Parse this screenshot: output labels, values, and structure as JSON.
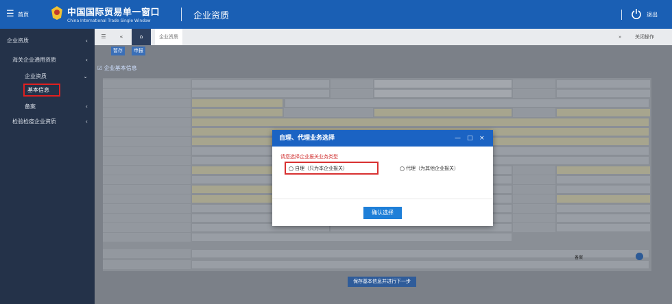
{
  "header": {
    "home_label": "首页",
    "brand_cn": "中国国际贸易单一窗口",
    "brand_en": "China International Trade Single Window",
    "module_title": "企业资质",
    "user_label": "退出"
  },
  "sidebar": {
    "items": [
      {
        "label": "企业资质"
      },
      {
        "label": "海关企业通用资质"
      },
      {
        "label": "企业资质"
      },
      {
        "label": "基本信息"
      },
      {
        "label": "备案"
      },
      {
        "label": "检验检疫企业资质"
      }
    ]
  },
  "tabbar": {
    "tab_label": "企业资质",
    "right_label": "关闭操作"
  },
  "actions": {
    "btn1": "暂存",
    "btn2": "申报"
  },
  "section": {
    "title": "企业基本信息"
  },
  "modal": {
    "title": "自理、代理业务选择",
    "question": "请您选择企业报关业务类型",
    "option1": "自理（只为本企业报关）",
    "option2": "代理（为其他企业报关）",
    "confirm": "确认选择"
  },
  "footer": {
    "next": "保存基本信息并进行下一步",
    "tag": "备案"
  },
  "colors": {
    "header": "#1a5fb4",
    "sidebar": "#243249",
    "modal_head": "#1b63c3",
    "confirm": "#1e7fd8",
    "highlight": "#d83030"
  }
}
